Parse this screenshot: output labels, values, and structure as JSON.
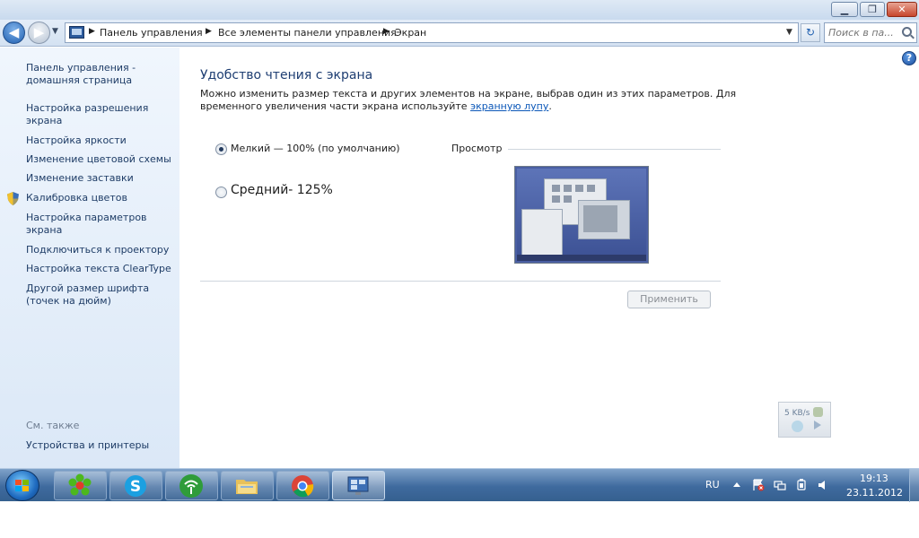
{
  "window": {
    "minimize_glyph": "▁",
    "maximize_glyph": "❐",
    "close_glyph": "✕"
  },
  "navigation": {
    "back_glyph": "◀",
    "forward_glyph": "▶",
    "history_glyph": "▼",
    "breadcrumbs": [
      "Панель управления",
      "Все элементы панели управления",
      "Экран"
    ],
    "breadcrumb_separator": "▶",
    "address_dropdown_glyph": "▼",
    "refresh_glyph": "↻",
    "search_placeholder": "Поиск в па..."
  },
  "sidebar": {
    "items": [
      {
        "label": "Панель управления - домашняя страница"
      },
      {
        "label": "Настройка разрешения экрана"
      },
      {
        "label": "Настройка яркости"
      },
      {
        "label": "Изменение цветовой схемы"
      },
      {
        "label": "Изменение заставки"
      },
      {
        "label": "Калибровка цветов"
      },
      {
        "label": "Настройка параметров экрана"
      },
      {
        "label": "Подключиться к проектору"
      },
      {
        "label": "Настройка текста ClearType"
      },
      {
        "label": "Другой размер шрифта (точек на дюйм)"
      }
    ],
    "see_also_label": "См. также",
    "see_also_items": [
      {
        "label": "Устройства и принтеры"
      }
    ]
  },
  "main": {
    "help_glyph": "?",
    "title": "Удобство чтения с экрана",
    "description_line1": "Можно изменить размер текста и других элементов на экране, выбрав один из этих параметров. Для",
    "description_line2_prefix": "временного увеличения части экрана используйте ",
    "magnifier_link": "экранную лупу",
    "description_line2_suffix": ".",
    "options": [
      {
        "label": "Мелкий — 100% (по умолчанию)",
        "selected": true
      },
      {
        "label": "Средний- 125%",
        "selected": false
      }
    ],
    "preview_label": "Просмотр",
    "apply_button": "Применить"
  },
  "gadget": {
    "speed": "5 KB/s"
  },
  "taskbar": {
    "apps": [
      {
        "name": "ICQ",
        "active": false
      },
      {
        "name": "Skype",
        "active": false
      },
      {
        "name": "Network",
        "active": false
      },
      {
        "name": "Explorer",
        "active": false
      },
      {
        "name": "Chrome",
        "active": false
      },
      {
        "name": "Display",
        "active": true
      }
    ],
    "language": "RU",
    "time": "19:13",
    "date": "23.11.2012"
  },
  "colors": {
    "link": "#1e3c66",
    "title": "#1e3e72",
    "sidebar_bg": "#e6f0fa",
    "taskbar": "#3f6a9e",
    "close_button": "#c7462d"
  }
}
